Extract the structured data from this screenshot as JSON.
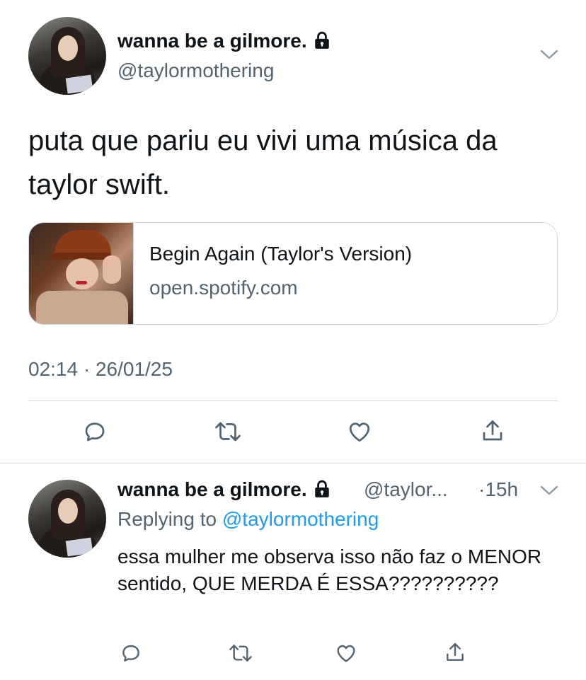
{
  "tweet": {
    "display_name": "wanna be a gilmore.",
    "handle": "@taylormothering",
    "text": "puta que pariu eu vivi uma música da taylor swift.",
    "card": {
      "title": "Begin Again (Taylor's Version)",
      "domain": "open.spotify.com"
    },
    "timestamp": "02:14 · 26/01/25",
    "icons": [
      "lock-icon",
      "chevron-down-icon",
      "reply-icon",
      "retweet-icon",
      "like-icon",
      "share-icon"
    ]
  },
  "reply": {
    "display_name": "wanna be a gilmore.",
    "handle": "@taylor...",
    "time": "·15h",
    "replying_label": "Replying to",
    "replying_to": "@taylormothering",
    "text": "essa mulher me observa isso não faz o MENOR sentido, QUE MERDA É ESSA??????????"
  },
  "colors": {
    "text": "#0f1419",
    "secondary": "#536471",
    "link": "#1d9bf0",
    "border": "#cfd9de"
  }
}
